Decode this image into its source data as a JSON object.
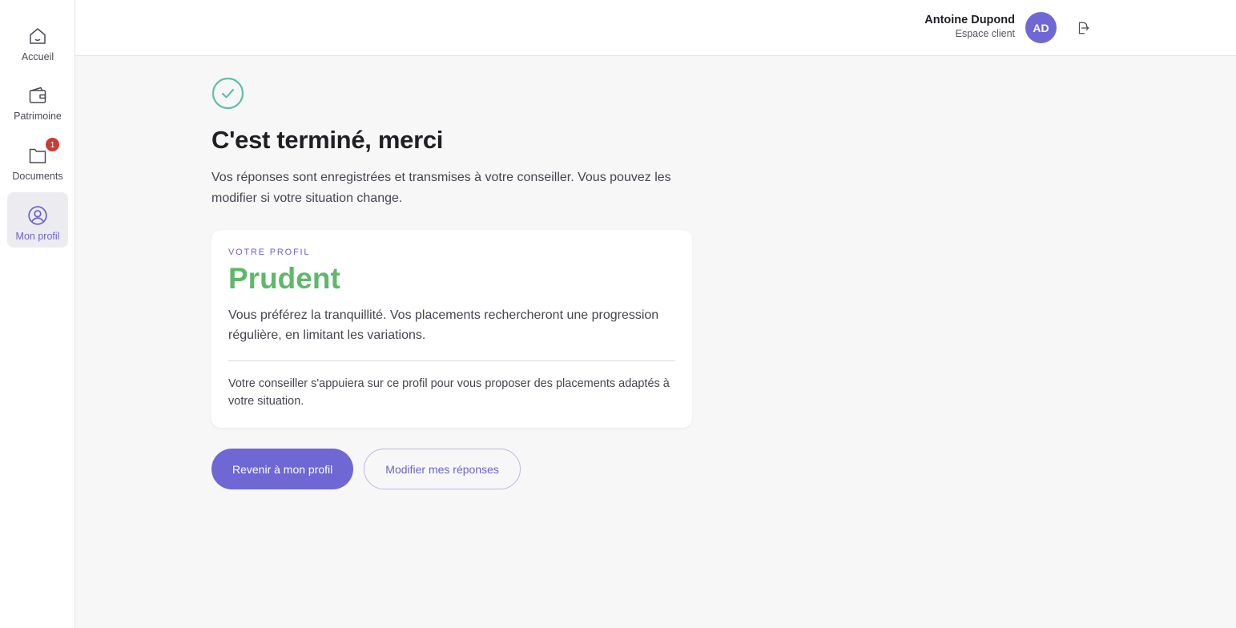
{
  "sidebar": {
    "items": [
      {
        "label": "Accueil",
        "icon": "home-icon"
      },
      {
        "label": "Patrimoine",
        "icon": "wallet-icon"
      },
      {
        "label": "Documents",
        "icon": "folder-icon",
        "badge": "1"
      },
      {
        "label": "Mon profil",
        "icon": "user-circle-icon",
        "active": true
      }
    ]
  },
  "header": {
    "user_name": "Antoine Dupond",
    "user_subtitle": "Espace client",
    "avatar_initials": "AD",
    "logout_icon": "logout-icon"
  },
  "main": {
    "status_icon": "check-circle-icon",
    "title": "C'est terminé, merci",
    "intro": "Vos réponses sont enregistrées et transmises à votre conseiller. Vous pouvez les modifier si votre situation change.",
    "card": {
      "eyebrow": "Votre profil",
      "profile": "Prudent",
      "description": "Vous préférez la tranquillité. Vos placements rechercheront une progression régulière, en limitant les variations.",
      "note": "Votre conseiller s'appuiera sur ce profil pour vous proposer des placements adaptés à votre situation."
    },
    "buttons": {
      "primary": "Revenir à mon profil",
      "secondary": "Modifier mes réponses"
    }
  },
  "colors": {
    "accent": "#6f67d4",
    "profile_green": "#5fb86a",
    "check_teal": "#5fbfa8",
    "badge_red": "#c93b34"
  }
}
